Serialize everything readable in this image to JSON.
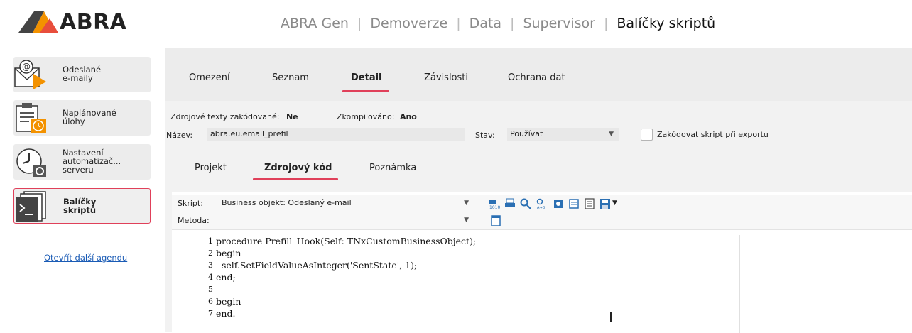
{
  "header": {
    "logo_text": "ABRA",
    "nav": [
      {
        "label": "ABRA Gen"
      },
      {
        "label": "Demoverze"
      },
      {
        "label": "Data"
      },
      {
        "label": "Supervisor"
      },
      {
        "label": "Balíčky skriptů"
      }
    ],
    "separator": "|"
  },
  "sidebar": {
    "items": [
      {
        "line1": "Odeslané",
        "line2": "e-maily",
        "line3": "",
        "icon": "email-send-icon"
      },
      {
        "line1": "Naplánované",
        "line2": "úlohy",
        "line3": "",
        "icon": "scheduled-task-icon"
      },
      {
        "line1": "Nastavení",
        "line2": "automatizač...",
        "line3": "serveru",
        "icon": "clock-gear-icon"
      },
      {
        "line1": "Balíčky",
        "line2": "skriptů",
        "line3": "",
        "icon": "script-package-icon"
      }
    ],
    "more_link": "Otevřít další agendu"
  },
  "tabs": [
    {
      "label": "Omezení"
    },
    {
      "label": "Seznam"
    },
    {
      "label": "Detail"
    },
    {
      "label": "Závislosti"
    },
    {
      "label": "Ochrana dat"
    }
  ],
  "info": {
    "encoded_label": "Zdrojové texty zakódované:",
    "encoded_value": "Ne",
    "compiled_label": "Zkompilováno:",
    "compiled_value": "Ano"
  },
  "form": {
    "name_label": "Název:",
    "name_value": "abra.eu.email_prefil",
    "state_label": "Stav:",
    "state_value": "Používat",
    "encode_label": "Zakódovat skript při exportu"
  },
  "subtabs": [
    {
      "label": "Projekt"
    },
    {
      "label": "Zdrojový kód"
    },
    {
      "label": "Poznámka"
    }
  ],
  "editor": {
    "script_label": "Skript:",
    "script_value": "Business objekt: Odeslaný e-mail",
    "method_label": "Metoda:",
    "method_value": "",
    "lines": [
      {
        "n": "1",
        "code": "procedure Prefill_Hook(Self: TNxCustomBusinessObject);"
      },
      {
        "n": "2",
        "code": "begin"
      },
      {
        "n": "3",
        "code": "  self.SetFieldValueAsInteger('SentState', 1);"
      },
      {
        "n": "4",
        "code": "end;"
      },
      {
        "n": "5",
        "code": ""
      },
      {
        "n": "6",
        "code": "begin"
      },
      {
        "n": "7",
        "code": "end."
      }
    ]
  },
  "colors": {
    "accent": "#e0405a",
    "link": "#1a5bb5",
    "logo_orange": "#f39200",
    "logo_red": "#e84e3c"
  }
}
